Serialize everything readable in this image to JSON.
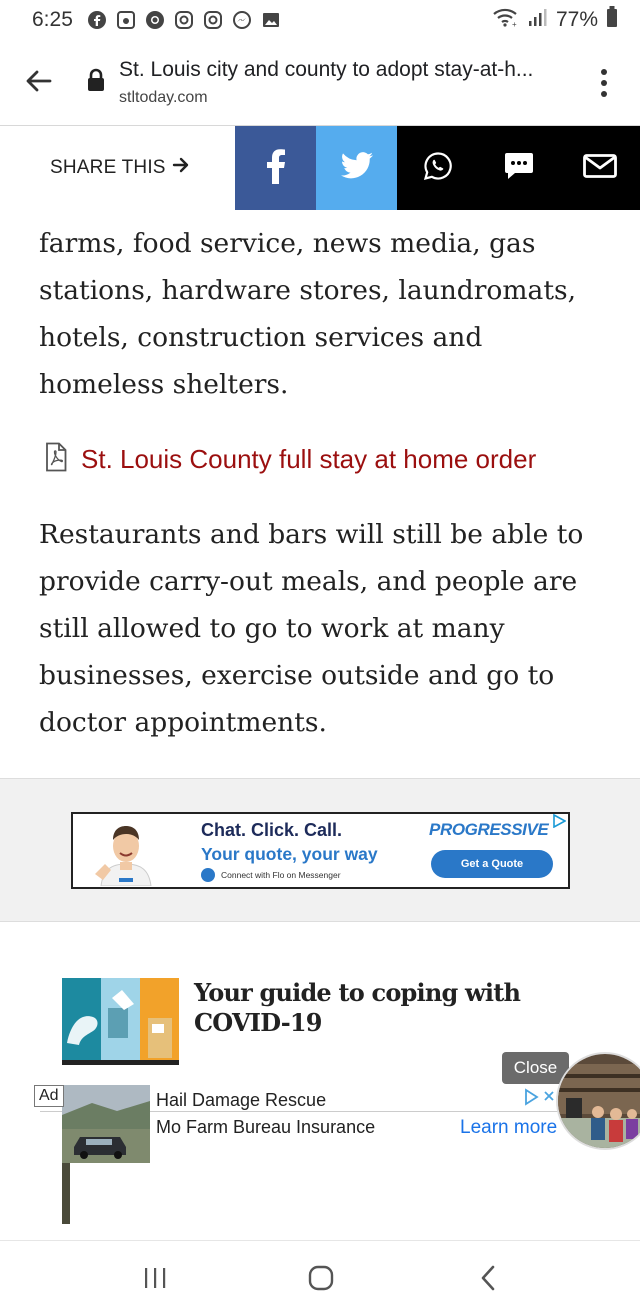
{
  "status_bar": {
    "time": "6:25",
    "battery": "77%",
    "notification_icons": [
      "facebook-icon",
      "google-fit-icon",
      "chrome-icon",
      "instagram-icon",
      "instagram-icon",
      "messenger-icon",
      "gallery-icon"
    ]
  },
  "browser": {
    "title": "St. Louis city and county to adopt stay-at-h...",
    "domain": "stltoday.com"
  },
  "share_bar": {
    "label": "SHARE THIS",
    "buttons": [
      "facebook",
      "twitter",
      "whatsapp",
      "sms",
      "email"
    ],
    "colors": {
      "facebook": "#3b5998",
      "twitter": "#55acee",
      "dark": "#000000"
    }
  },
  "article": {
    "para1": "farms, food service, news media, gas stations, hardware stores, laundromats, hotels, construction services and homeless shelters.",
    "pdf_link": "St. Louis County full stay at home order",
    "para2": "Restaurants and bars will still be able to provide carry-out meals, and people are still allowed to go to work at many businesses, exercise outside and go to doctor appointments."
  },
  "banner_ad": {
    "headline": "Chat. Click. Call.",
    "subhead": "Your quote, your way",
    "messenger_text": "Connect with Flo on Messenger",
    "brand": "PROGRESSIVE",
    "cta": "Get a Quote"
  },
  "related": {
    "title": "Your guide to coping with COVID-19"
  },
  "sticky_ad": {
    "badge": "Ad",
    "line1": "Hail Damage Rescue",
    "line2": "Mo Farm Bureau Insurance",
    "cta": "Learn more",
    "close": "Close"
  }
}
